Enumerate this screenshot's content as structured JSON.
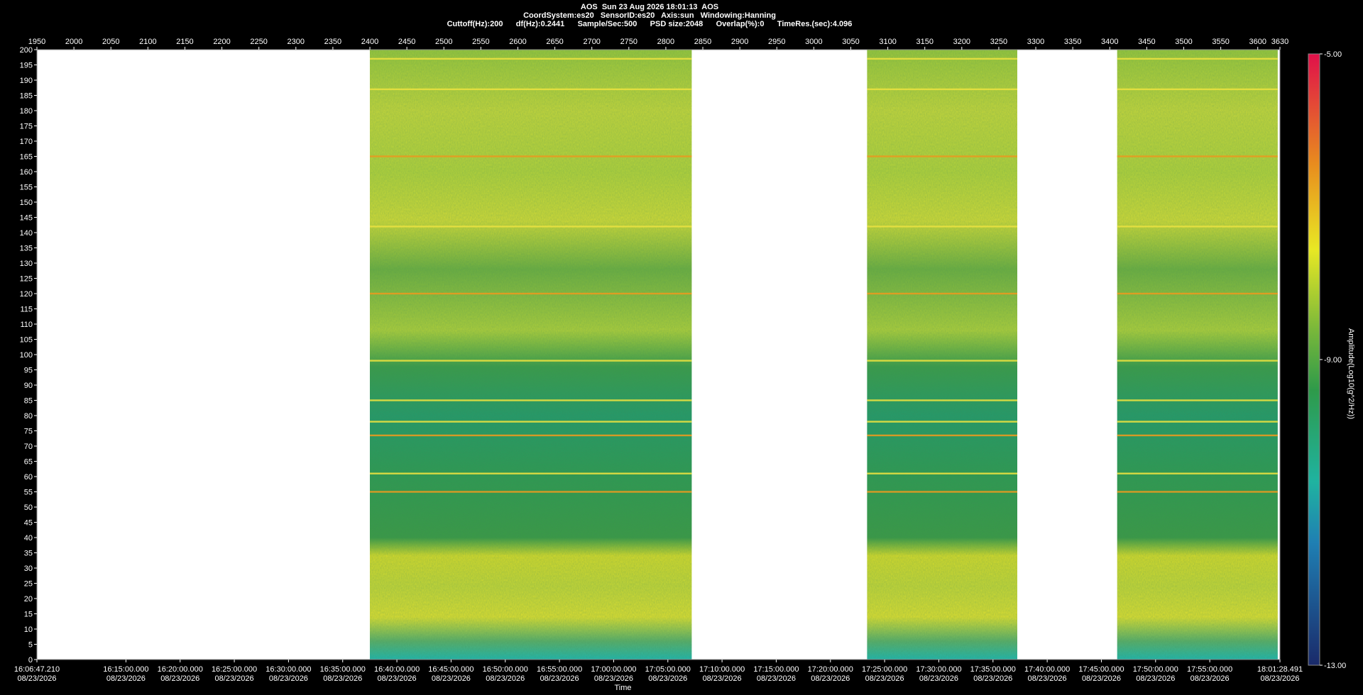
{
  "header": {
    "line1": "AOS  Sun 23 Aug 2026 18:01:13  AOS",
    "line2": "CoordSystem:es20   SensorID:es20   Axis:sun   Windowing:Hanning",
    "line3": "Cuttoff(Hz):200      df(Hz):0.2441      Sample/Sec:500      PSD size:2048      Overlap(%):0      TimeRes.(sec):4.096"
  },
  "chart_data": {
    "type": "heatmap",
    "title": "AOS  Sun 23 Aug 2026 18:01:13  AOS",
    "xlabel": "Time",
    "ylabel": "",
    "colorbar_label": "Amplitude(Log10(g^2/Hz))",
    "colorbar_ticks": [
      "-5.00",
      "-9.00",
      "-13.00"
    ],
    "colorbar_range": [
      -13,
      -5
    ],
    "colors": [
      "#1a2a6a",
      "#1fb3b3",
      "#2e9a4a",
      "#e8e824",
      "#e88c1e",
      "#e0104a"
    ],
    "top_axis_ticks": [
      "1950",
      "2000",
      "2050",
      "2100",
      "2150",
      "2200",
      "2250",
      "2300",
      "2350",
      "2400",
      "2450",
      "2500",
      "2550",
      "2600",
      "2650",
      "2700",
      "2750",
      "2800",
      "2850",
      "2900",
      "2950",
      "3000",
      "3050",
      "3100",
      "3150",
      "3200",
      "3250",
      "3300",
      "3350",
      "3400",
      "3450",
      "3500",
      "3550",
      "3600",
      "3630"
    ],
    "top_axis_range": [
      1950,
      3630
    ],
    "y_ticks": [
      0,
      5,
      10,
      15,
      20,
      25,
      30,
      35,
      40,
      45,
      50,
      55,
      60,
      65,
      70,
      75,
      80,
      85,
      90,
      95,
      100,
      105,
      110,
      115,
      120,
      125,
      130,
      135,
      140,
      145,
      150,
      155,
      160,
      165,
      170,
      175,
      180,
      185,
      190,
      195,
      200
    ],
    "y_range": [
      0,
      200
    ],
    "x_ticks": [
      {
        "time": "16:06:47.210",
        "date": "08/23/2026"
      },
      {
        "time": "16:15:00.000",
        "date": "08/23/2026"
      },
      {
        "time": "16:20:00.000",
        "date": "08/23/2026"
      },
      {
        "time": "16:25:00.000",
        "date": "08/23/2026"
      },
      {
        "time": "16:30:00.000",
        "date": "08/23/2026"
      },
      {
        "time": "16:35:00.000",
        "date": "08/23/2026"
      },
      {
        "time": "16:40:00.000",
        "date": "08/23/2026"
      },
      {
        "time": "16:45:00.000",
        "date": "08/23/2026"
      },
      {
        "time": "16:50:00.000",
        "date": "08/23/2026"
      },
      {
        "time": "16:55:00.000",
        "date": "08/23/2026"
      },
      {
        "time": "17:00:00.000",
        "date": "08/23/2026"
      },
      {
        "time": "17:05:00.000",
        "date": "08/23/2026"
      },
      {
        "time": "17:10:00.000",
        "date": "08/23/2026"
      },
      {
        "time": "17:15:00.000",
        "date": "08/23/2026"
      },
      {
        "time": "17:20:00.000",
        "date": "08/23/2026"
      },
      {
        "time": "17:25:00.000",
        "date": "08/23/2026"
      },
      {
        "time": "17:30:00.000",
        "date": "08/23/2026"
      },
      {
        "time": "17:35:00.000",
        "date": "08/23/2026"
      },
      {
        "time": "17:40:00.000",
        "date": "08/23/2026"
      },
      {
        "time": "17:45:00.000",
        "date": "08/23/2026"
      },
      {
        "time": "17:50:00.000",
        "date": "08/23/2026"
      },
      {
        "time": "17:55:00.000",
        "date": "08/23/2026"
      },
      {
        "time": "18:01:28.491",
        "date": "08/23/2026"
      }
    ],
    "data_segments": [
      {
        "start": 2400,
        "end": 2835
      },
      {
        "start": 3072,
        "end": 3275
      },
      {
        "start": 3410,
        "end": 3627
      }
    ],
    "spectral_lines_hz": [
      {
        "freq": 197,
        "level": "yellow"
      },
      {
        "freq": 187,
        "level": "yellow"
      },
      {
        "freq": 165,
        "level": "orange"
      },
      {
        "freq": 142,
        "level": "yellow"
      },
      {
        "freq": 120,
        "level": "orange"
      },
      {
        "freq": 98,
        "level": "yellow"
      },
      {
        "freq": 85,
        "level": "yellow"
      },
      {
        "freq": 78,
        "level": "yellow"
      },
      {
        "freq": 73.5,
        "level": "orange"
      },
      {
        "freq": 61,
        "level": "yellow"
      },
      {
        "freq": 55,
        "level": "orange"
      }
    ],
    "noise_bands_hz": [
      {
        "from": 125,
        "to": 200,
        "level": "yellow-green"
      },
      {
        "from": 105,
        "to": 125,
        "level": "green"
      },
      {
        "from": 35,
        "to": 105,
        "level": "teal-green"
      },
      {
        "from": 15,
        "to": 35,
        "level": "yellow"
      },
      {
        "from": 0,
        "to": 15,
        "level": "yellow-teal"
      }
    ]
  }
}
